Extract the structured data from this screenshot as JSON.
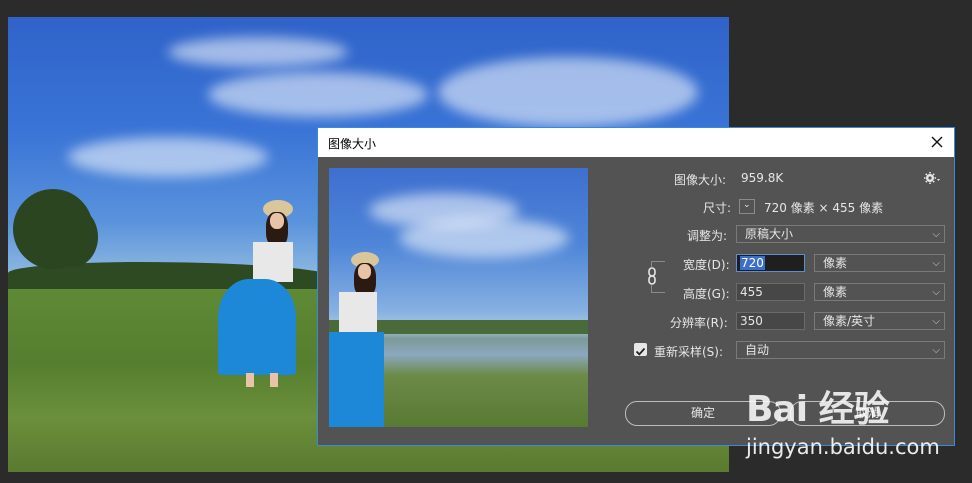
{
  "dialog": {
    "title": "图像大小",
    "image_size_label": "图像大小:",
    "image_size_value": "959.8K",
    "dimensions_label": "尺寸:",
    "dimensions_value": "720 像素 × 455 像素",
    "resize_label": "调整为:",
    "resize_value": "原稿大小",
    "width_label": "宽度(D):",
    "width_value": "720",
    "width_unit": "像素",
    "height_label": "高度(G):",
    "height_value": "455",
    "height_unit": "像素",
    "resolution_label": "分辨率(R):",
    "resolution_value": "350",
    "resolution_unit": "像素/英寸",
    "resample_label": "重新采样(S):",
    "resample_checked": true,
    "resample_value": "自动",
    "ok_label": "确定",
    "cancel_label": "取消"
  },
  "icons": {
    "close": "close-icon",
    "gear": "gear-icon",
    "link": "chain-link-icon",
    "chevron": "chevron-down-icon",
    "check": "checkmark-icon"
  },
  "watermark": {
    "logo": "Bai 经验",
    "url": "jingyan.baidu.com"
  },
  "colors": {
    "dialog_bg": "#535353",
    "accent": "#3a8ad8",
    "text": "#e6e6e6"
  }
}
